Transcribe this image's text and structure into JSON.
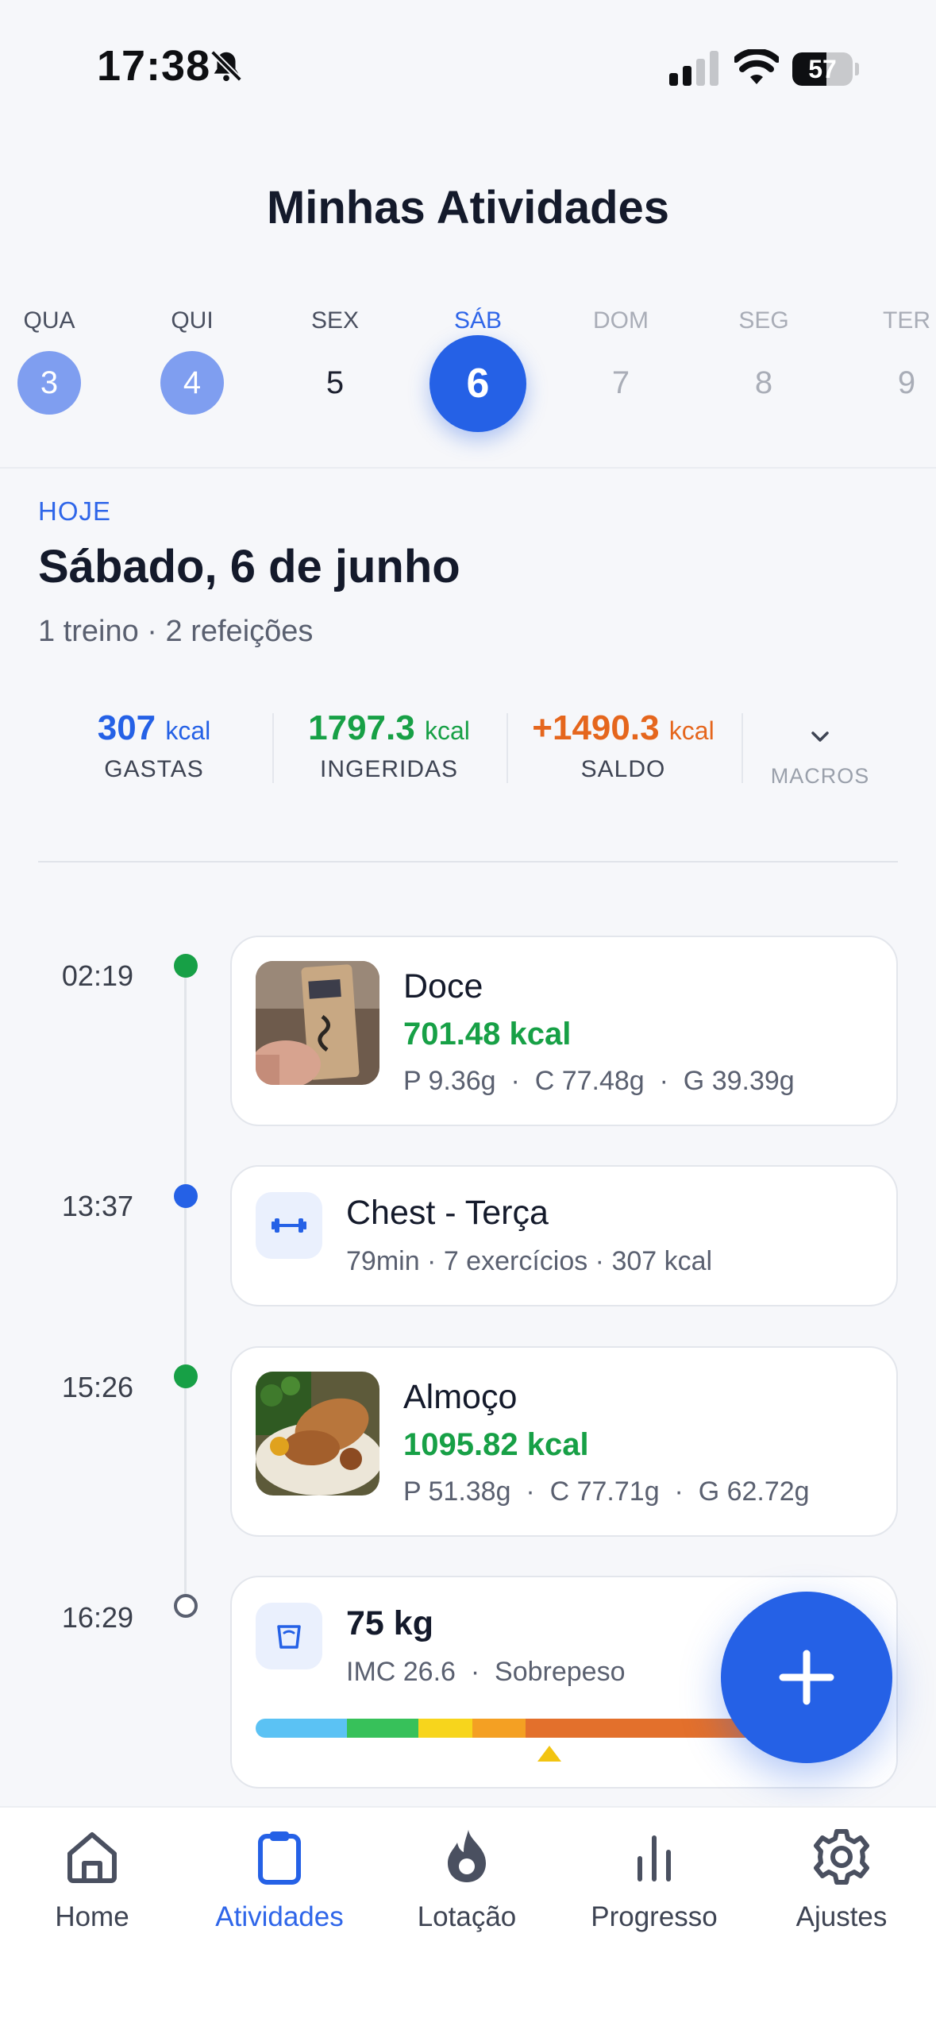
{
  "status_bar": {
    "time": "17:38",
    "battery": "57",
    "battery_level": 0.57
  },
  "title": "Minhas Atividades",
  "days": [
    {
      "weekday": "QUA",
      "num": "3",
      "state": "done"
    },
    {
      "weekday": "QUI",
      "num": "4",
      "state": "done"
    },
    {
      "weekday": "SEX",
      "num": "5",
      "state": "plain"
    },
    {
      "weekday": "SÁB",
      "num": "6",
      "state": "selected"
    },
    {
      "weekday": "DOM",
      "num": "7",
      "state": "future"
    },
    {
      "weekday": "SEG",
      "num": "8",
      "state": "future"
    },
    {
      "weekday": "TER",
      "num": "9",
      "state": "future"
    }
  ],
  "header": {
    "today_label": "HOJE",
    "date_title": "Sábado, 6 de junho",
    "summary": "1 treino · 2 refeições"
  },
  "stats": {
    "burned": {
      "value": "307",
      "unit": "kcal",
      "label": "GASTAS",
      "color": "#2561e6"
    },
    "ingested": {
      "value": "1797.3",
      "unit": "kcal",
      "label": "INGERIDAS",
      "color": "#17a046"
    },
    "balance": {
      "value": "+1490.3",
      "unit": "kcal",
      "label": "SALDO",
      "color": "#e5661d"
    },
    "macros_label": "MACROS"
  },
  "timeline": {
    "meal1": {
      "time": "02:19",
      "title": "Doce",
      "kcal": "701.48 kcal",
      "macros": "P 9.36g  ·  C 77.48g  ·  G 39.39g",
      "dot_color": "#17a046"
    },
    "workout": {
      "time": "13:37",
      "title": "Chest - Terça",
      "details": "79min · 7 exercícios · 307 kcal",
      "dot_color": "#2561e6",
      "icon": "dumbbell-icon"
    },
    "meal2": {
      "time": "15:26",
      "title": "Almoço",
      "kcal": "1095.82 kcal",
      "macros": "P 51.38g  ·  C 77.71g  ·  G 62.72g",
      "dot_color": "#17a046"
    },
    "weight": {
      "time": "16:29",
      "title": "75 kg",
      "details": "IMC 26.6  ·  Sobrepeso",
      "icon": "scale-icon",
      "bmi": 26.6,
      "bar_colors": [
        "#5bc2f4",
        "#37c15a",
        "#f7d51c",
        "#f4a023",
        "#e3702c"
      ]
    }
  },
  "fab": {
    "icon": "plus-icon"
  },
  "tabs": [
    {
      "label": "Home",
      "icon": "home-icon",
      "active": false
    },
    {
      "label": "Atividades",
      "icon": "clipboard-icon",
      "active": true
    },
    {
      "label": "Lotação",
      "icon": "flame-icon",
      "active": false
    },
    {
      "label": "Progresso",
      "icon": "bar-chart-icon",
      "active": false
    },
    {
      "label": "Ajustes",
      "icon": "gear-icon",
      "active": false
    }
  ]
}
